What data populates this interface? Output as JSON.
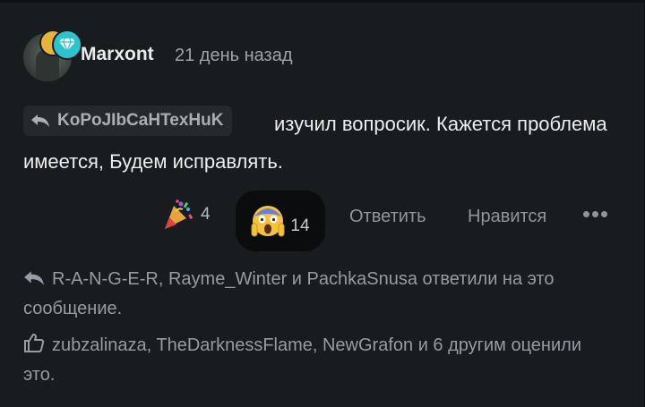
{
  "header": {
    "username": "Marxont",
    "timestamp": "21 день назад"
  },
  "message": {
    "mention": "KoPoJIbCaHTexHuK",
    "text": "изучил вопросик. Кажется проблема имеется, Будем исправлять."
  },
  "reactions": [
    {
      "icon": "party-popper-icon",
      "count": "4"
    },
    {
      "icon": "screaming-face-icon",
      "count": "14"
    }
  ],
  "actions": {
    "reply_label": "Ответить",
    "like_label": "Нравится"
  },
  "footer": {
    "replies_text": "R-A-N-G-E-R, Rayme_Winter и PachkaSnusa ответили на это сообщение.",
    "likes_text": "zubzalinaza, TheDarknessFlame, NewGrafon и 6 другим оценили это."
  },
  "colors": {
    "background": "#181c1f",
    "badge_gold": "#e9b33a",
    "badge_diamond": "#2cc3cf"
  }
}
